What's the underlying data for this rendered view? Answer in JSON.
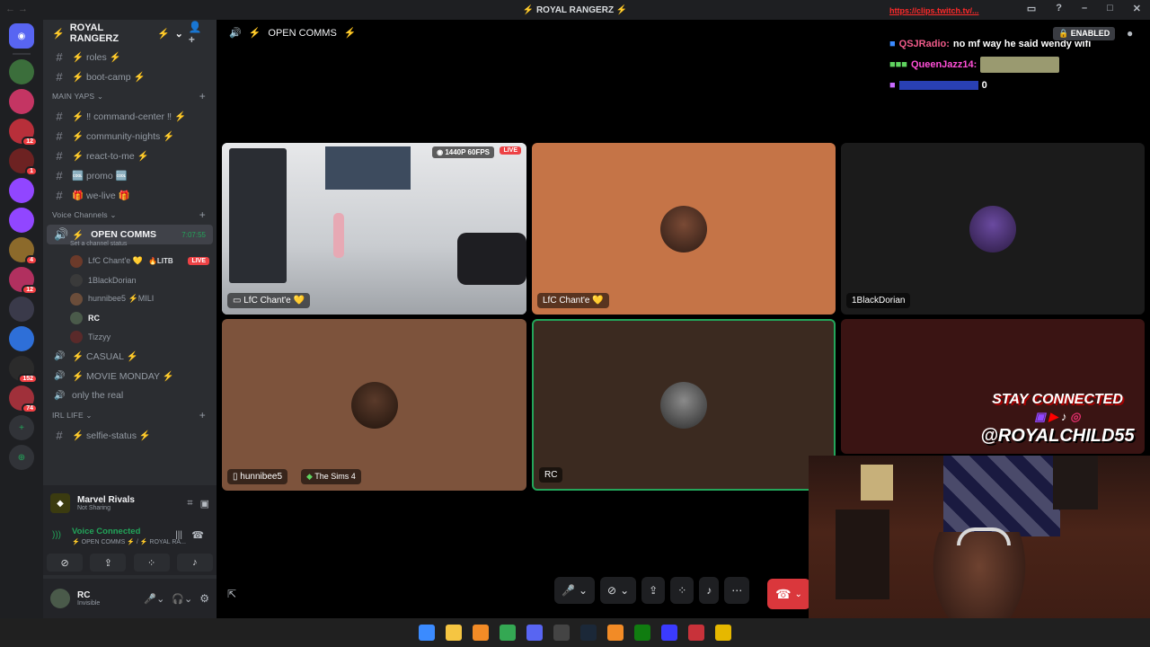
{
  "window": {
    "title": "ROYAL RANGERZ",
    "title_prefix_icon": "⚡"
  },
  "servers": {
    "items": [
      {
        "name": "discord-home",
        "color": "#5865f2",
        "badge": ""
      },
      {
        "name": "server-1",
        "color": "#3b6e3b",
        "badge": ""
      },
      {
        "name": "server-2",
        "color": "#c43563",
        "badge": ""
      },
      {
        "name": "server-3",
        "color": "#b82f3a",
        "badge": "12"
      },
      {
        "name": "server-4",
        "color": "#6d2222",
        "badge": "1"
      },
      {
        "name": "server-twitch-1",
        "color": "#9146ff",
        "badge": ""
      },
      {
        "name": "server-twitch-2",
        "color": "#9146ff",
        "badge": ""
      },
      {
        "name": "server-5",
        "color": "#8c6a2b",
        "badge": "4"
      },
      {
        "name": "server-6",
        "color": "#b1305f",
        "badge": "12"
      },
      {
        "name": "server-7",
        "color": "#3a3a4a",
        "badge": ""
      },
      {
        "name": "server-wave",
        "color": "#2e6fd8",
        "badge": ""
      },
      {
        "name": "server-8",
        "color": "#2b2b2b",
        "badge": "152"
      },
      {
        "name": "server-9",
        "color": "#a0303a",
        "badge": "74"
      }
    ]
  },
  "sidebar": {
    "guild_name": "ROYAL RANGERZ",
    "channels_top": [
      {
        "label": "roles",
        "decor": "⚡"
      },
      {
        "label": "boot-camp",
        "decor": "⚡"
      }
    ],
    "category_main": "MAIN YAPS",
    "channels_main": [
      {
        "label": "‼ command-center ‼",
        "decor": "⚡"
      },
      {
        "label": "community-nights",
        "decor": "⚡"
      },
      {
        "label": "react-to-me",
        "decor": "⚡"
      },
      {
        "label": "🆒 promo 🆒",
        "decor": ""
      },
      {
        "label": "🎁 we-live 🎁",
        "decor": ""
      }
    ],
    "category_voice": "Voice Channels",
    "active_voice": {
      "label": "OPEN COMMS",
      "timer": "7:07:55",
      "status": "Set a channel status"
    },
    "voice_users": [
      {
        "name": "LfC Chant'e 💛",
        "tag": "🔥LITB",
        "live": "LIVE"
      },
      {
        "name": "1BlackDorian",
        "tag": "",
        "live": ""
      },
      {
        "name": "hunnibee5 ⚡MILI",
        "tag": "",
        "live": ""
      },
      {
        "name": "RC",
        "tag": "",
        "live": ""
      },
      {
        "name": "Tizzyy",
        "tag": "",
        "live": ""
      }
    ],
    "voice_channels": [
      {
        "label": "CASUAL",
        "decor": "⚡"
      },
      {
        "label": "MOVIE MONDAY",
        "decor": "⚡"
      },
      {
        "label": "only the real",
        "decor": ""
      }
    ],
    "category_irl": "IRL LIFE",
    "channels_irl": [
      {
        "label": "selfie-status",
        "decor": "⚡"
      }
    ]
  },
  "activity": {
    "game": "Marvel Rivals",
    "state": "Not Sharing"
  },
  "voice_connection": {
    "status": "Voice Connected",
    "location": "⚡ OPEN COMMS ⚡ / ⚡ ROYAL RA..."
  },
  "user": {
    "name": "RC",
    "status": "Invisible"
  },
  "call": {
    "title": "OPEN COMMS",
    "tiles": [
      {
        "name": "LfC Chant'e 💛",
        "bg": "#8a8c8f",
        "stream": true,
        "stream_quality": "1440P 60FPS",
        "live": "LIVE"
      },
      {
        "name": "LfC Chant'e 💛",
        "bg": "#c57447"
      },
      {
        "name": "1BlackDorian",
        "bg": "#1b1b1b"
      },
      {
        "name": "hunnibee5",
        "bg": "#7d533c",
        "activity": "The Sims 4"
      },
      {
        "name": "RC",
        "bg": "#3b2a20",
        "speaking": true
      },
      {
        "name": "",
        "bg": "#3a1413"
      }
    ]
  },
  "chat": {
    "link": "https://clips.twitch.tv/...",
    "enabled_label": "ENABLED",
    "messages": [
      {
        "user": "QSJRadio:",
        "text": "no mf way he said wendy wifi",
        "user_color": "#f05b8a"
      },
      {
        "user": "QueenJazz14:",
        "text": "",
        "user_color": "#ff4fd8"
      },
      {
        "user": "",
        "text": "0",
        "user_color": "#3b5bff"
      }
    ]
  },
  "overlay": {
    "line1": "STAY CONNECTED",
    "line2": "@ROYALCHILD55"
  },
  "taskbar": {
    "icons": [
      "windows-start",
      "file-explorer",
      "fl-studio",
      "chrome",
      "discord",
      "obs",
      "steam",
      "fl-studio-2",
      "xbox",
      "app-grid",
      "app-red",
      "app-yellow"
    ]
  }
}
